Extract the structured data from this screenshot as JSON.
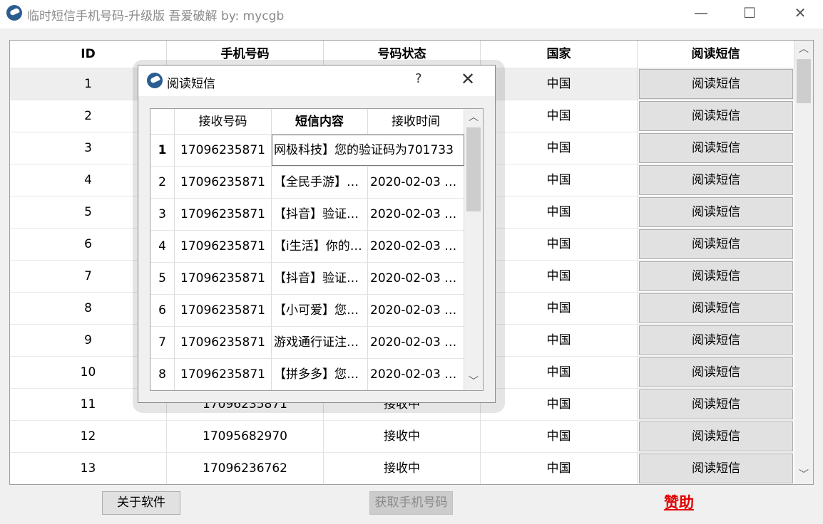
{
  "window": {
    "title": "临时短信手机号码-升级版 吾爱破解 by: mycgb",
    "minimize_glyph": "—",
    "maximize_glyph": "☐",
    "close_glyph": "✕"
  },
  "main_table": {
    "columns": [
      "ID",
      "手机号码",
      "号码状态",
      "国家",
      "阅读短信"
    ],
    "rows": [
      {
        "id": "1",
        "phone": "",
        "status": "",
        "country": "中国",
        "action": "阅读短信"
      },
      {
        "id": "2",
        "phone": "",
        "status": "",
        "country": "中国",
        "action": "阅读短信"
      },
      {
        "id": "3",
        "phone": "",
        "status": "",
        "country": "中国",
        "action": "阅读短信"
      },
      {
        "id": "4",
        "phone": "",
        "status": "",
        "country": "中国",
        "action": "阅读短信"
      },
      {
        "id": "5",
        "phone": "",
        "status": "",
        "country": "中国",
        "action": "阅读短信"
      },
      {
        "id": "6",
        "phone": "",
        "status": "",
        "country": "中国",
        "action": "阅读短信"
      },
      {
        "id": "7",
        "phone": "",
        "status": "",
        "country": "中国",
        "action": "阅读短信"
      },
      {
        "id": "8",
        "phone": "",
        "status": "",
        "country": "中国",
        "action": "阅读短信"
      },
      {
        "id": "9",
        "phone": "",
        "status": "",
        "country": "中国",
        "action": "阅读短信"
      },
      {
        "id": "10",
        "phone": "",
        "status": "",
        "country": "中国",
        "action": "阅读短信"
      },
      {
        "id": "11",
        "phone": "17096235871",
        "status": "接收中",
        "country": "中国",
        "action": "阅读短信"
      },
      {
        "id": "12",
        "phone": "17095682970",
        "status": "接收中",
        "country": "中国",
        "action": "阅读短信"
      },
      {
        "id": "13",
        "phone": "17096236762",
        "status": "接收中",
        "country": "中国",
        "action": "阅读短信"
      }
    ]
  },
  "bottom": {
    "about_label": "关于软件",
    "get_phone_label": "获取手机号码",
    "sponsor_label": "赞助"
  },
  "dialog": {
    "title": "阅读短信",
    "help_glyph": "?",
    "close_glyph": "✕",
    "columns": [
      "接收号码",
      "短信内容",
      "接收时间"
    ],
    "editing_value": "网极科技】您的验证码为701733",
    "rows": [
      {
        "idx": "1",
        "phone": "17096235871",
        "content": "",
        "time": ""
      },
      {
        "idx": "2",
        "phone": "17096235871",
        "content": "【全民手游】…",
        "time": "2020-02-03 …"
      },
      {
        "idx": "3",
        "phone": "17096235871",
        "content": "【抖音】验证…",
        "time": "2020-02-03 …"
      },
      {
        "idx": "4",
        "phone": "17096235871",
        "content": "【i生活】你的…",
        "time": "2020-02-03 …"
      },
      {
        "idx": "5",
        "phone": "17096235871",
        "content": "【抖音】验证…",
        "time": "2020-02-03 …"
      },
      {
        "idx": "6",
        "phone": "17096235871",
        "content": "【小可爱】您…",
        "time": "2020-02-03 …"
      },
      {
        "idx": "7",
        "phone": "17096235871",
        "content": "游戏通行证注…",
        "time": "2020-02-03 …"
      },
      {
        "idx": "8",
        "phone": "17096235871",
        "content": "【拼多多】您…",
        "time": "2020-02-03 …"
      }
    ]
  },
  "scroll": {
    "up_glyph": "︿",
    "down_glyph": "﹀"
  }
}
